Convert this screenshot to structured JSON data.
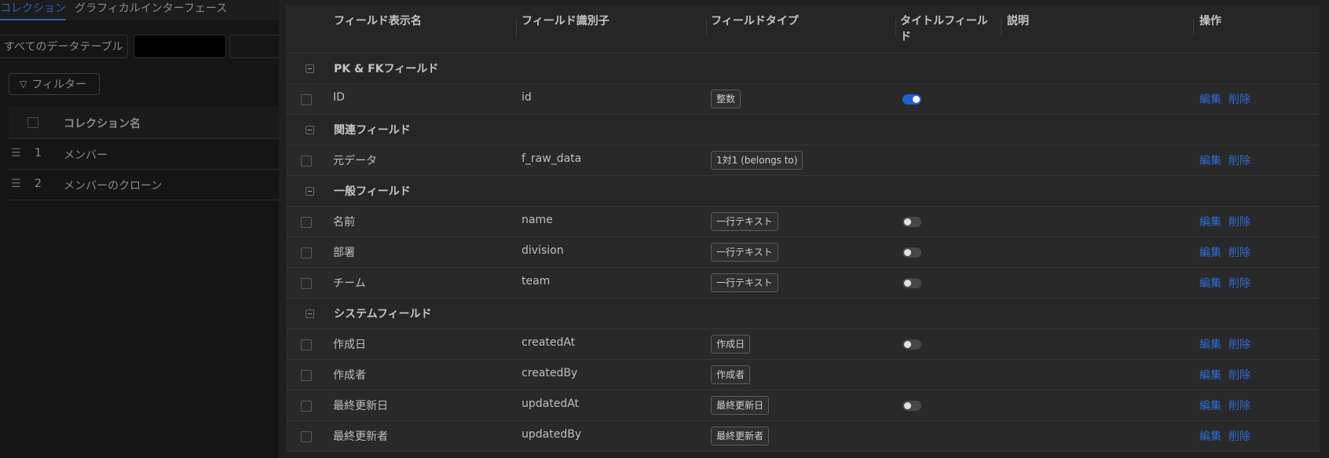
{
  "left": {
    "tabs": [
      "コレクション",
      "グラフィカルインターフェース"
    ],
    "table_filter_tab": "すべてのデータテーブル",
    "filter_label": "フィルター",
    "collections_header": "コレクション名",
    "collections": [
      {
        "num": "1",
        "name": "メンバー"
      },
      {
        "num": "2",
        "name": "メンバーのクローン"
      }
    ]
  },
  "fields_table": {
    "headers": {
      "display_name": "フィールド表示名",
      "identifier": "フィールド識別子",
      "type": "フィールドタイプ",
      "title_field": "タイトルフィールド",
      "description": "説明",
      "actions": "操作"
    },
    "edit_label": "編集",
    "delete_label": "削除",
    "groups": [
      {
        "name": "PK & FKフィールド",
        "rows": [
          {
            "title": "ID",
            "identifier": "id",
            "type": "整数",
            "title_switch": "on"
          }
        ]
      },
      {
        "name": "関連フィールド",
        "rows": [
          {
            "title": "元データ",
            "identifier": "f_raw_data",
            "type": "1対1 (belongs to)",
            "title_switch": "none"
          }
        ]
      },
      {
        "name": "一般フィールド",
        "rows": [
          {
            "title": "名前",
            "identifier": "name",
            "type": "一行テキスト",
            "title_switch": "off"
          },
          {
            "title": "部署",
            "identifier": "division",
            "type": "一行テキスト",
            "title_switch": "off"
          },
          {
            "title": "チーム",
            "identifier": "team",
            "type": "一行テキスト",
            "title_switch": "off"
          }
        ]
      },
      {
        "name": "システムフィールド",
        "rows": [
          {
            "title": "作成日",
            "identifier": "createdAt",
            "type": "作成日",
            "title_switch": "off"
          },
          {
            "title": "作成者",
            "identifier": "createdBy",
            "type": "作成者",
            "title_switch": "none"
          },
          {
            "title": "最終更新日",
            "identifier": "updatedAt",
            "type": "最終更新日",
            "title_switch": "off"
          },
          {
            "title": "最終更新者",
            "identifier": "updatedBy",
            "type": "最終更新者",
            "title_switch": "none"
          }
        ]
      }
    ]
  }
}
